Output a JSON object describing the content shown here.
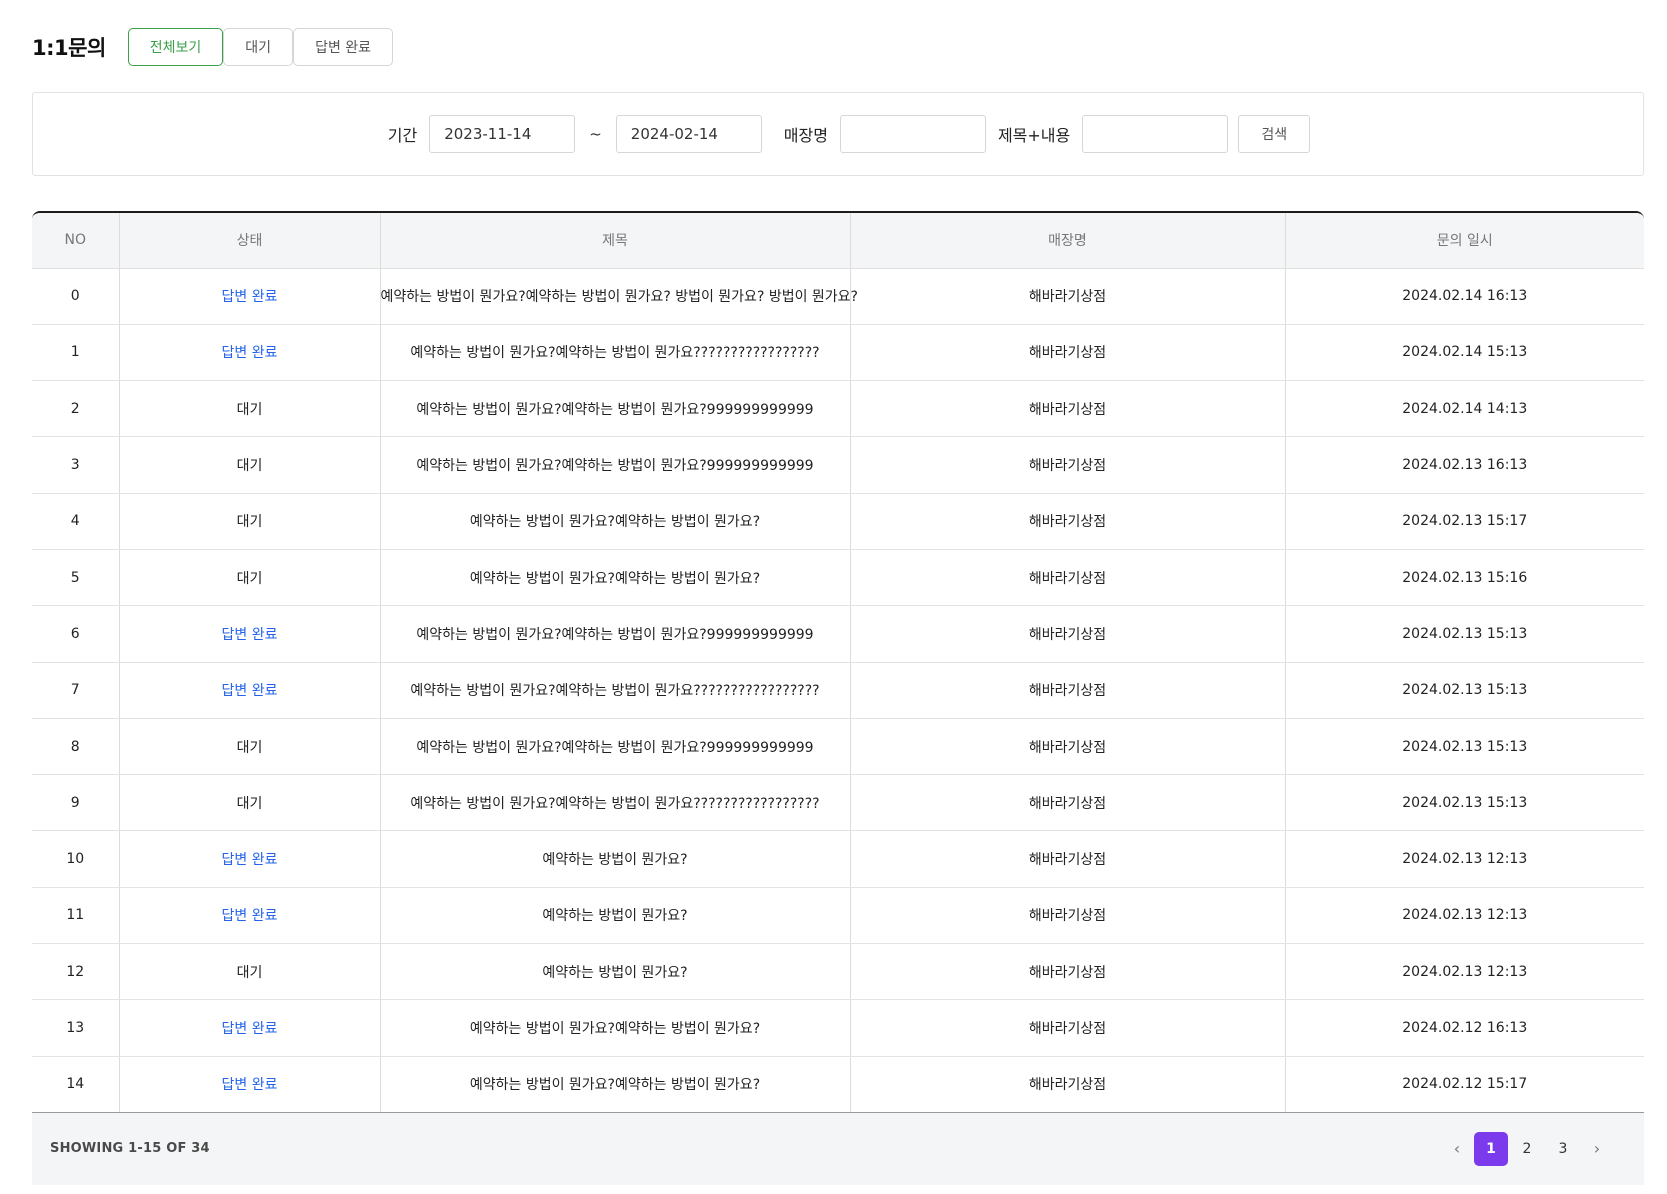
{
  "header": {
    "title": "1:1문의",
    "tabs": [
      {
        "label": "전체보기",
        "active": true
      },
      {
        "label": "대기",
        "active": false
      },
      {
        "label": "답변 완료",
        "active": false
      }
    ]
  },
  "search": {
    "period_label": "기간",
    "start_date": "2023-11-14",
    "tilde": "~",
    "end_date": "2024-02-14",
    "store_label": "매장명",
    "store_value": "",
    "keyword_label": "제목+내용",
    "keyword_value": "",
    "button_label": "검색"
  },
  "table": {
    "columns": [
      "NO",
      "상태",
      "제목",
      "매장명",
      "문의 일시"
    ],
    "rows": [
      {
        "no": "0",
        "status": "답변 완료",
        "done": true,
        "title": "예약하는 방법이 뭔가요?예약하는 방법이 뭔가요? 방법이 뭔가요? 방법이 뭔가요?",
        "store": "해바라기상점",
        "date": "2024.02.14 16:13"
      },
      {
        "no": "1",
        "status": "답변 완료",
        "done": true,
        "title": "예약하는 방법이 뭔가요?예약하는 방법이 뭔가요?????????????????",
        "store": "해바라기상점",
        "date": "2024.02.14 15:13"
      },
      {
        "no": "2",
        "status": "대기",
        "done": false,
        "title": "예약하는 방법이 뭔가요?예약하는 방법이 뭔가요?999999999999",
        "store": "해바라기상점",
        "date": "2024.02.14 14:13"
      },
      {
        "no": "3",
        "status": "대기",
        "done": false,
        "title": "예약하는 방법이 뭔가요?예약하는 방법이 뭔가요?999999999999",
        "store": "해바라기상점",
        "date": "2024.02.13 16:13"
      },
      {
        "no": "4",
        "status": "대기",
        "done": false,
        "title": "예약하는 방법이 뭔가요?예약하는 방법이 뭔가요?",
        "store": "해바라기상점",
        "date": "2024.02.13 15:17"
      },
      {
        "no": "5",
        "status": "대기",
        "done": false,
        "title": "예약하는 방법이 뭔가요?예약하는 방법이 뭔가요?",
        "store": "해바라기상점",
        "date": "2024.02.13 15:16"
      },
      {
        "no": "6",
        "status": "답변 완료",
        "done": true,
        "title": "예약하는 방법이 뭔가요?예약하는 방법이 뭔가요?999999999999",
        "store": "해바라기상점",
        "date": "2024.02.13 15:13"
      },
      {
        "no": "7",
        "status": "답변 완료",
        "done": true,
        "title": "예약하는 방법이 뭔가요?예약하는 방법이 뭔가요?????????????????",
        "store": "해바라기상점",
        "date": "2024.02.13 15:13"
      },
      {
        "no": "8",
        "status": "대기",
        "done": false,
        "title": "예약하는 방법이 뭔가요?예약하는 방법이 뭔가요?999999999999",
        "store": "해바라기상점",
        "date": "2024.02.13 15:13"
      },
      {
        "no": "9",
        "status": "대기",
        "done": false,
        "title": "예약하는 방법이 뭔가요?예약하는 방법이 뭔가요?????????????????",
        "store": "해바라기상점",
        "date": "2024.02.13 15:13"
      },
      {
        "no": "10",
        "status": "답변 완료",
        "done": true,
        "title": "예약하는 방법이 뭔가요?",
        "store": "해바라기상점",
        "date": "2024.02.13 12:13"
      },
      {
        "no": "11",
        "status": "답변 완료",
        "done": true,
        "title": "예약하는 방법이 뭔가요?",
        "store": "해바라기상점",
        "date": "2024.02.13 12:13"
      },
      {
        "no": "12",
        "status": "대기",
        "done": false,
        "title": "예약하는 방법이 뭔가요?",
        "store": "해바라기상점",
        "date": "2024.02.13 12:13"
      },
      {
        "no": "13",
        "status": "답변 완료",
        "done": true,
        "title": "예약하는 방법이 뭔가요?예약하는 방법이 뭔가요?",
        "store": "해바라기상점",
        "date": "2024.02.12 16:13"
      },
      {
        "no": "14",
        "status": "답변 완료",
        "done": true,
        "title": "예약하는 방법이 뭔가요?예약하는 방법이 뭔가요?",
        "store": "해바라기상점",
        "date": "2024.02.12 15:17"
      }
    ]
  },
  "footer": {
    "showing": "SHOWING 1-15 OF 34",
    "pages": [
      "1",
      "2",
      "3"
    ],
    "current_page": "1",
    "prev_icon": "chevron-left-icon",
    "next_icon": "chevron-right-icon"
  },
  "colors": {
    "active_tab": "#3aa14a",
    "status_done": "#2563eb",
    "current_page": "#7c3aed"
  }
}
